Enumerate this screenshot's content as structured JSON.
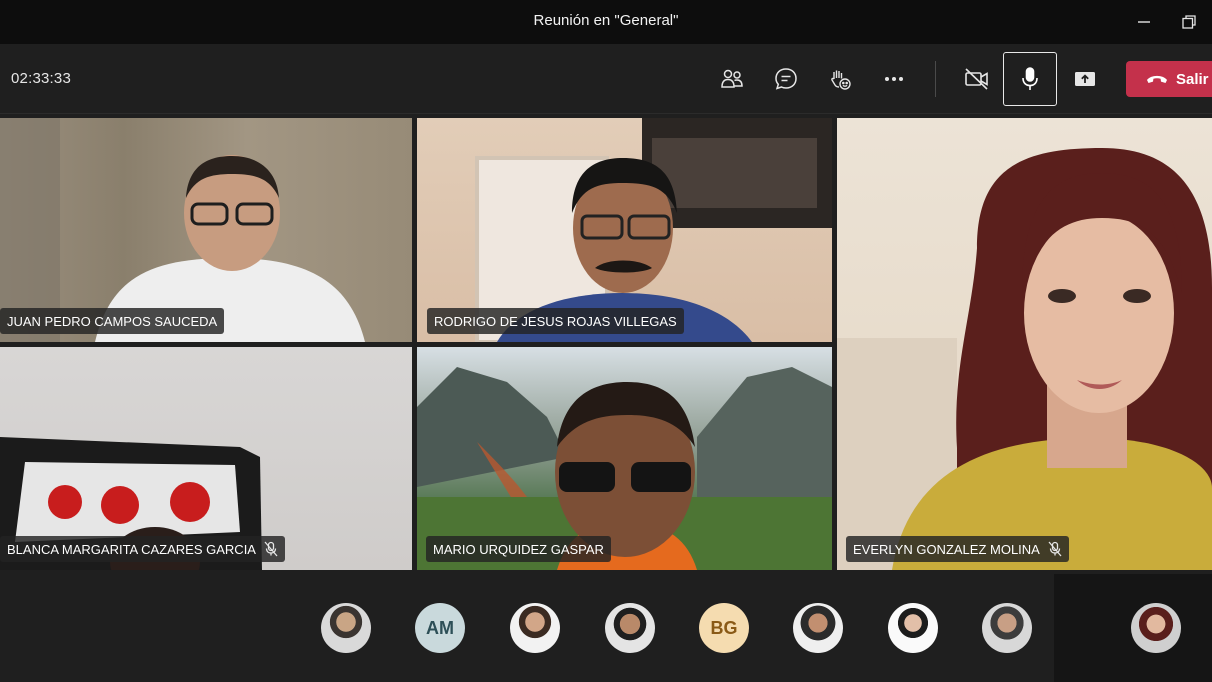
{
  "window": {
    "title": "Reunión en \"General\""
  },
  "toolbar": {
    "timer": "02:33:33",
    "leave_label": "Salir"
  },
  "participants": [
    {
      "name": "JUAN PEDRO CAMPOS SAUCEDA",
      "muted": false
    },
    {
      "name": "RODRIGO DE JESUS ROJAS VILLEGAS",
      "muted": false
    },
    {
      "name": "EVERLYN GONZALEZ MOLINA",
      "muted": true
    },
    {
      "name": "BLANCA MARGARITA CAZARES GARCIA",
      "muted": true
    },
    {
      "name": "MARIO URQUIDEZ GASPAR",
      "muted": false
    }
  ],
  "roster": [
    {
      "type": "photo"
    },
    {
      "type": "initials",
      "initials": "AM",
      "bg": "#c9d9dc",
      "fg": "#2d4f57"
    },
    {
      "type": "photo"
    },
    {
      "type": "photo"
    },
    {
      "type": "initials",
      "initials": "BG",
      "bg": "#f5dcb0",
      "fg": "#8a5a16"
    },
    {
      "type": "photo"
    },
    {
      "type": "photo"
    },
    {
      "type": "photo"
    }
  ],
  "colors": {
    "leave": "#c4314b",
    "background": "#1f1f1f",
    "titlebar": "#0d0d0d"
  },
  "icons": [
    "minimize-icon",
    "restore-icon",
    "people-icon",
    "chat-icon",
    "raise-hand-icon",
    "more-icon",
    "camera-off-icon",
    "microphone-icon",
    "share-screen-icon",
    "phone-hangup-icon",
    "mic-off-icon"
  ]
}
